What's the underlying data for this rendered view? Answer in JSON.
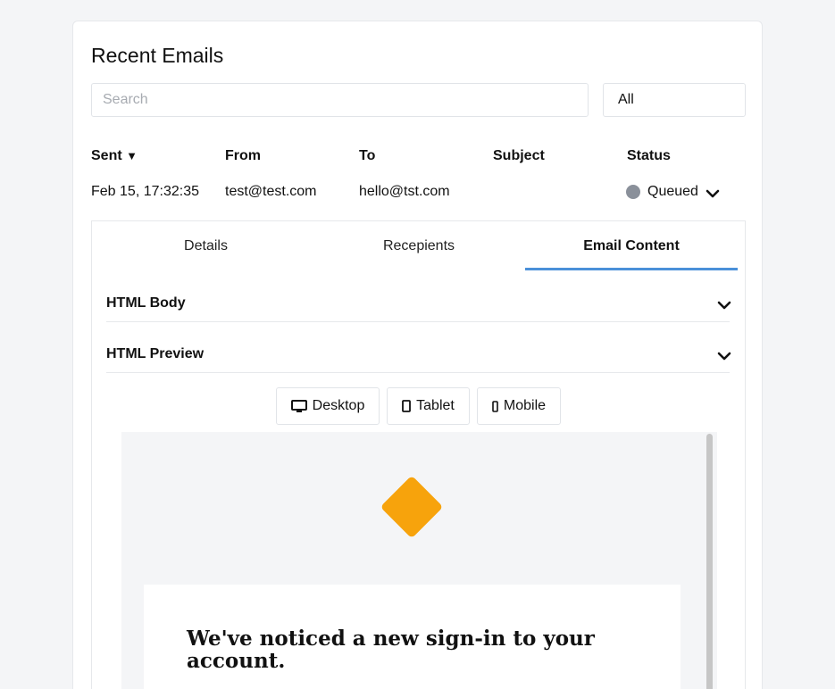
{
  "header": {
    "title": "Recent Emails"
  },
  "search": {
    "placeholder": "Search"
  },
  "filter": {
    "value": "All"
  },
  "table": {
    "columns": {
      "sent": "Sent",
      "sort_indicator": "▼",
      "from": "From",
      "to": "To",
      "subject": "Subject",
      "status": "Status"
    },
    "rows": [
      {
        "sent": "Feb 15, 17:32:35",
        "from": "test@test.com",
        "to": "hello@tst.com",
        "subject": "",
        "status": "Queued",
        "status_color": "#8a909a"
      }
    ]
  },
  "detail": {
    "tabs": [
      {
        "label": "Details",
        "active": false
      },
      {
        "label": "Recepients",
        "active": false
      },
      {
        "label": "Email Content",
        "active": true
      }
    ],
    "accordions": [
      {
        "label": "HTML Body",
        "icon": "chevron-down-icon"
      },
      {
        "label": "HTML Preview",
        "icon": "chevron-down-icon"
      }
    ],
    "view_modes": [
      {
        "label": "Desktop",
        "icon": "desktop-icon"
      },
      {
        "label": "Tablet",
        "icon": "tablet-icon"
      },
      {
        "label": "Mobile",
        "icon": "mobile-icon"
      }
    ],
    "preview": {
      "logo_color": "#f7a30c",
      "heading": "We've noticed a new sign-in to your account."
    }
  },
  "colors": {
    "accent": "#4a90d9",
    "status_queued": "#8a909a",
    "logo": "#f7a30c"
  }
}
